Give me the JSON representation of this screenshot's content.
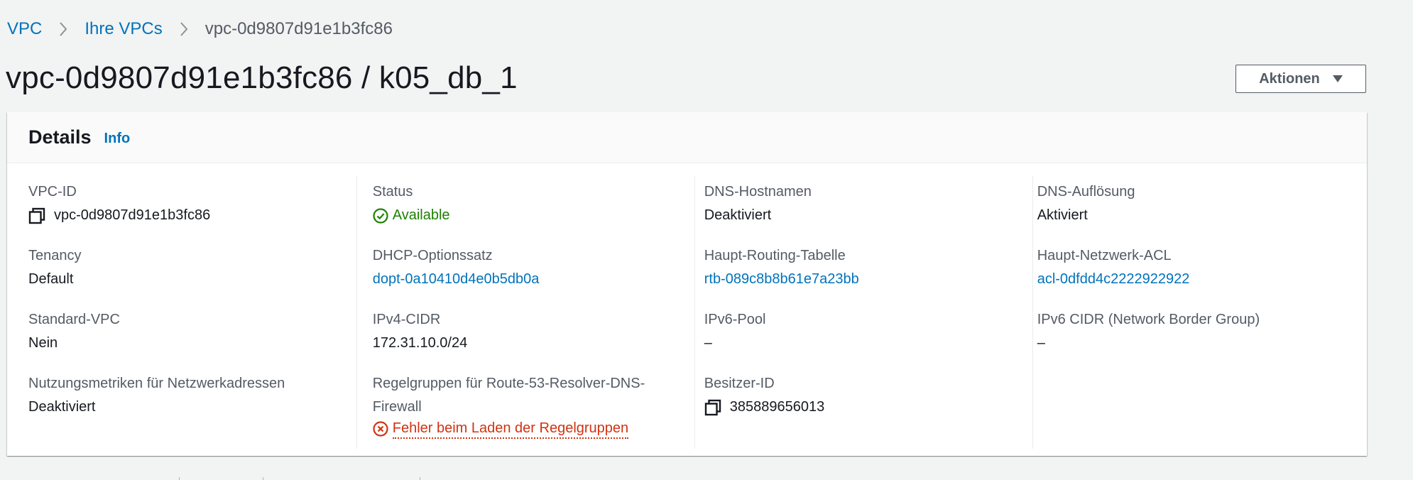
{
  "breadcrumb": {
    "items": [
      "VPC",
      "Ihre VPCs"
    ],
    "current": "vpc-0d9807d91e1b3fc86"
  },
  "page": {
    "title": "vpc-0d9807d91e1b3fc86 / k05_db_1",
    "actions_label": "Aktionen"
  },
  "details": {
    "title": "Details",
    "info_label": "Info",
    "columns": [
      [
        {
          "label": "VPC-ID",
          "value": "vpc-0d9807d91e1b3fc86"
        },
        {
          "label": "Tenancy",
          "value": "Default"
        },
        {
          "label": "Standard-VPC",
          "value": "Nein"
        },
        {
          "label": "Nutzungsmetriken für Netzwerkadressen",
          "value": "Deaktiviert"
        }
      ],
      [
        {
          "label": "Status",
          "value": "Available"
        },
        {
          "label": "DHCP-Optionssatz",
          "value": "dopt-0a10410d4e0b5db0a"
        },
        {
          "label": "IPv4-CIDR",
          "value": "172.31.10.0/24"
        },
        {
          "label": "Regelgruppen für Route-53-Resolver-DNS-Firewall",
          "value": "Fehler beim Laden der Regelgruppen"
        }
      ],
      [
        {
          "label": "DNS-Hostnamen",
          "value": "Deaktiviert"
        },
        {
          "label": "Haupt-Routing-Tabelle",
          "value": "rtb-089c8b8b61e7a23bb"
        },
        {
          "label": "IPv6-Pool",
          "value": "–"
        },
        {
          "label": "Besitzer-ID",
          "value": "385889656013"
        }
      ],
      [
        {
          "label": "DNS-Auflösung",
          "value": "Aktiviert"
        },
        {
          "label": "Haupt-Netzwerk-ACL",
          "value": "acl-0dfdd4c2222922922"
        },
        {
          "label": "IPv6 CIDR (Network Border Group)",
          "value": "–"
        }
      ]
    ]
  },
  "colors": {
    "link": "#0073bb",
    "success": "#1d8102",
    "error": "#d13212",
    "label": "#545b64",
    "text": "#16191f"
  },
  "icons": [
    "chevron-right-icon",
    "caret-down-icon",
    "copy-icon",
    "status-ok-icon",
    "status-error-icon"
  ]
}
